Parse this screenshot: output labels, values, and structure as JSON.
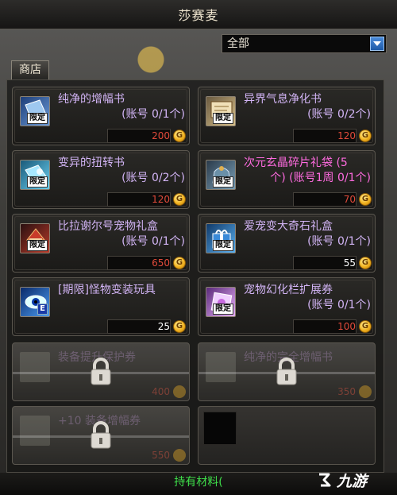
{
  "window": {
    "title": "莎赛麦"
  },
  "filter": {
    "selected": "全部"
  },
  "tabs": {
    "shop": "商店"
  },
  "items": [
    {
      "name": "纯净的增幅书",
      "limit": "(账号 0/1个)",
      "price": "200",
      "tag": "限定",
      "icon": "book-icon",
      "color": "#4a7ab8"
    },
    {
      "name": "异界气息净化书",
      "limit": "(账号 0/2个)",
      "price": "120",
      "tag": "限定",
      "icon": "scroll-icon",
      "color": "#c8b08a"
    },
    {
      "name": "变异的扭转书",
      "limit": "(账号 0/2个)",
      "price": "120",
      "tag": "限定",
      "icon": "book-icon",
      "color": "#3aa0c8"
    },
    {
      "name": "次元玄晶碎片礼袋 (5",
      "name2": "个) (账号1周 0/1个)",
      "price": "70",
      "tag": "限定",
      "icon": "bag-icon",
      "color": "#5a7a92",
      "pink": true
    },
    {
      "name": "比拉谢尔号宠物礼盒",
      "limit": "(账号 0/1个)",
      "price": "650",
      "tag": "限定",
      "icon": "pet-box-icon",
      "color": "#b83a2a"
    },
    {
      "name": "爱宠变大奇石礼盒",
      "limit": "(账号 0/1个)",
      "price": "55",
      "tag": "限定",
      "icon": "gift-box-icon",
      "color": "#3a7ac8",
      "white_price": true
    },
    {
      "name": "[期限]怪物变装玩具",
      "limit": "",
      "price": "25",
      "tag": "E",
      "icon": "monster-eye-icon",
      "color": "#2a5ab8",
      "white_price": true
    },
    {
      "name": "宠物幻化栏扩展券",
      "limit": "(账号 0/1个)",
      "price": "100",
      "tag": "限定",
      "icon": "ticket-icon",
      "color": "#c88ad8"
    }
  ],
  "locked_items": [
    {
      "name": "装备提升保护券",
      "price": "400"
    },
    {
      "name": "纯净的完全增幅书",
      "price": "350"
    },
    {
      "name": "+10 装备增幅券",
      "price": "550"
    }
  ],
  "coin_symbol": "G",
  "footer": {
    "text": "持有材料("
  },
  "watermark": {
    "text": "九游"
  }
}
